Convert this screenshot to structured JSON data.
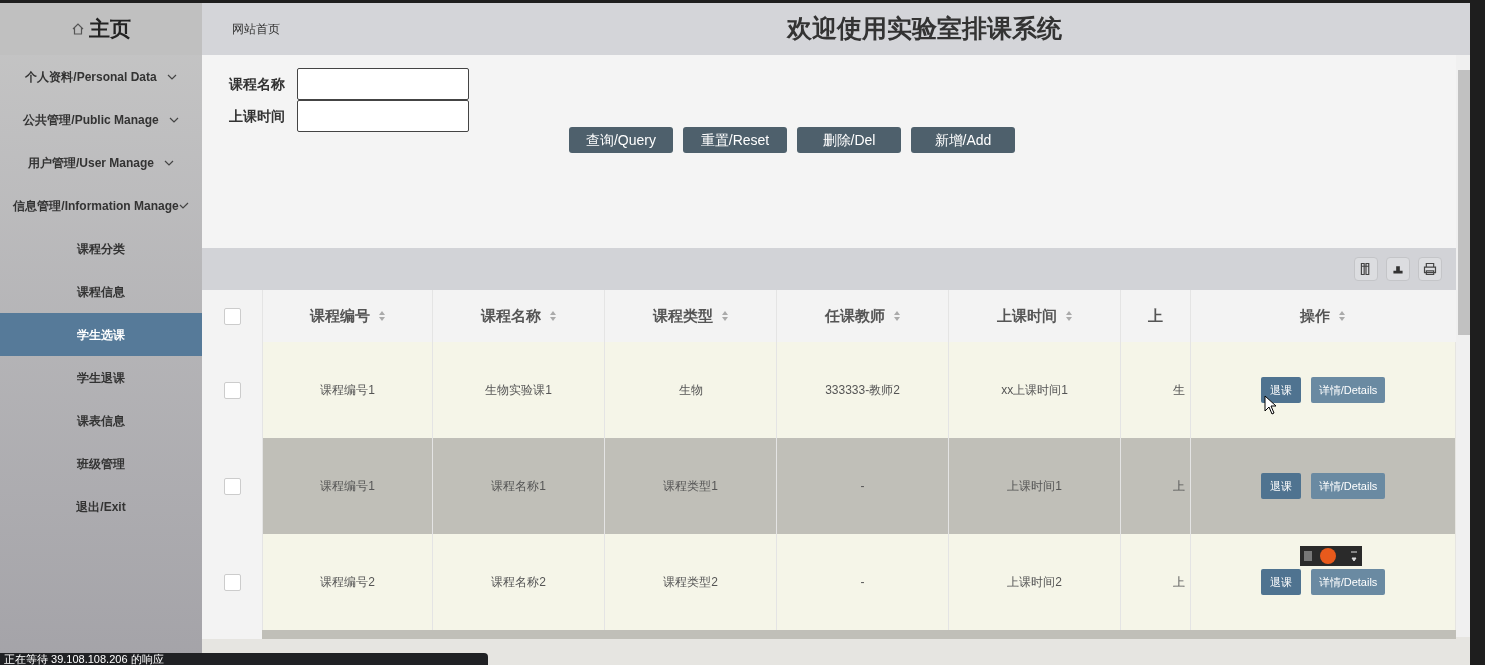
{
  "sidebar": {
    "title": "主页",
    "items": [
      {
        "label": "个人资料/Personal Data",
        "kind": "group",
        "expanded": false,
        "selected": false
      },
      {
        "label": "公共管理/Public Manage",
        "kind": "group",
        "expanded": false,
        "selected": false
      },
      {
        "label": "用户管理/User Manage",
        "kind": "group",
        "expanded": false,
        "selected": false
      },
      {
        "label": "信息管理/Information Manage",
        "kind": "group",
        "expanded": true,
        "selected": false
      },
      {
        "label": "课程分类",
        "kind": "link",
        "selected": false
      },
      {
        "label": "课程信息",
        "kind": "link",
        "selected": false
      },
      {
        "label": "学生选课",
        "kind": "link",
        "selected": true
      },
      {
        "label": "学生退课",
        "kind": "link",
        "selected": false
      },
      {
        "label": "课表信息",
        "kind": "link",
        "selected": false
      },
      {
        "label": "班级管理",
        "kind": "link",
        "selected": false
      },
      {
        "label": "退出/Exit",
        "kind": "link",
        "selected": false
      }
    ]
  },
  "header": {
    "breadcrumb": "网站首页",
    "title": "欢迎使用实验室排课系统"
  },
  "filters": [
    {
      "label": "课程名称"
    },
    {
      "label": "上课时间"
    }
  ],
  "buttons": [
    "查询/Query",
    "重置/Reset",
    "删除/Del",
    "新增/Add"
  ],
  "table": {
    "all_checked": false,
    "columns": [
      "课程编号",
      "课程名称",
      "课程类型",
      "任课教师",
      "上课时间",
      "上",
      "操作"
    ],
    "rows": [
      {
        "checked": false,
        "cells": [
          "课程编号1",
          "生物实验课1",
          "生物",
          "333333-教师2",
          "xx上课时间1",
          "生"
        ],
        "actions": [
          "退课",
          "详情/Details"
        ]
      },
      {
        "checked": false,
        "cells": [
          "课程编号1",
          "课程名称1",
          "课程类型1",
          "-",
          "上课时间1",
          "上"
        ],
        "actions": [
          "退课",
          "详情/Details"
        ]
      },
      {
        "checked": false,
        "cells": [
          "课程编号2",
          "课程名称2",
          "课程类型2",
          "-",
          "上课时间2",
          "上"
        ],
        "actions": [
          "退课",
          "详情/Details"
        ]
      }
    ]
  },
  "status_bar": "正在等待 39.108.108.206 的响应"
}
